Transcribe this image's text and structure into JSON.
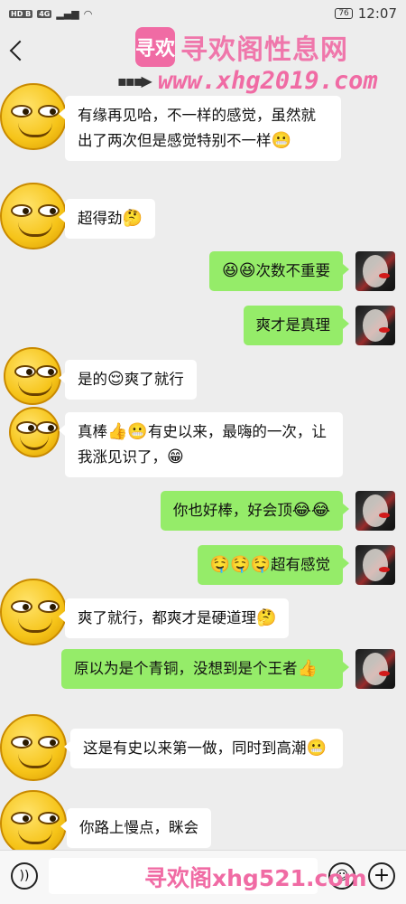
{
  "status_bar": {
    "left_tags": [
      "HD B",
      "4G",
      "HD B"
    ],
    "battery": "76",
    "time": "12:07"
  },
  "header": {
    "back_icon": "chevron-left-icon"
  },
  "watermark": {
    "logo_text": "寻欢",
    "title": "寻欢阁性息网",
    "url": "www.xhg2019.com",
    "bottom_url": "寻欢阁xhg521.com"
  },
  "messages": [
    {
      "dir": "in",
      "text": "有缘再见哈，不一样的感觉，虽然就出了两次但是感觉特别不一样",
      "emoji": "😬"
    },
    {
      "dir": "in",
      "text": "超得劲",
      "emoji": "🤔"
    },
    {
      "dir": "out",
      "text": "次数不重要",
      "emoji_prefix": "😆😆"
    },
    {
      "dir": "out",
      "text": "爽才是真理"
    },
    {
      "dir": "in",
      "text_a": "是的",
      "emoji_mid": "😌",
      "text_b": "爽了就行"
    },
    {
      "dir": "in",
      "text_a": "真棒",
      "emoji_mid": "👍😬",
      "text_b": "有史以来，最嗨的一次，让我涨见识了，",
      "emoji": "😁"
    },
    {
      "dir": "out",
      "text": "你也好棒，好会顶",
      "emoji": "😂😂"
    },
    {
      "dir": "out",
      "text": "超有感觉",
      "emoji_prefix": "🤤🤤🤤"
    },
    {
      "dir": "in",
      "text": "爽了就行，都爽才是硬道理",
      "emoji": "🤔"
    },
    {
      "dir": "out",
      "text": "原以为是个青铜，没想到是个王者",
      "emoji": "👍"
    },
    {
      "dir": "in",
      "text": "这是有史以来第一做，同时到高潮",
      "emoji": "😬"
    },
    {
      "dir": "in",
      "text": "你路上慢点，眯会"
    }
  ],
  "bottom_bar": {
    "voice_icon": "voice-icon",
    "emoji_icon": "emoji-icon",
    "plus_icon": "plus-icon"
  }
}
